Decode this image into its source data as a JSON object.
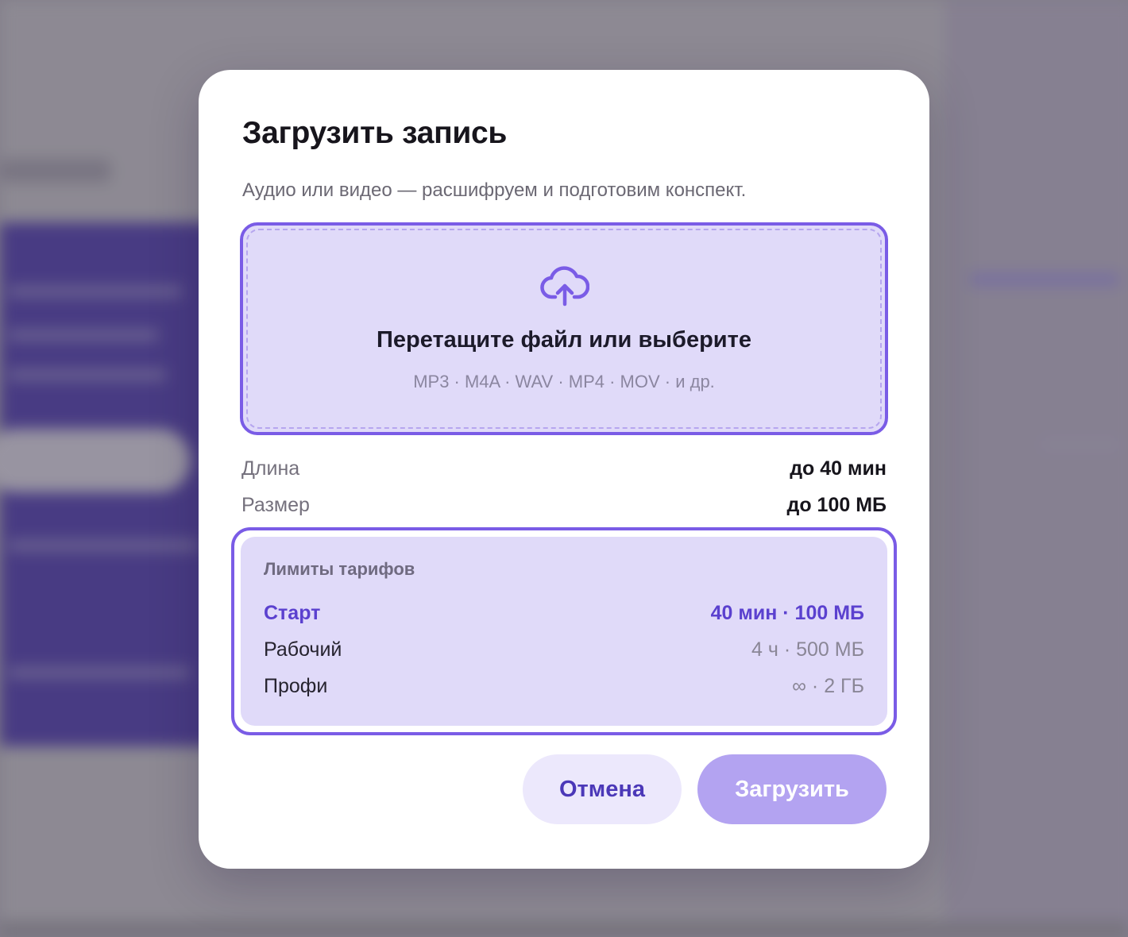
{
  "modal": {
    "title": "Загрузить запись",
    "subtitle": "Аудио или видео — расшифруем и подготовим конспект."
  },
  "dropzone": {
    "icon": "cloud-upload-icon",
    "title": "Перетащите файл или выберите",
    "formats": "MP3 · M4A · WAV · MP4 · MOV · и др."
  },
  "limits": [
    {
      "label": "Длина",
      "value": "до 40 мин"
    },
    {
      "label": "Размер",
      "value": "до 100 МБ"
    }
  ],
  "plans": {
    "heading": "Лимиты тарифов",
    "tiers": [
      {
        "name": "Старт",
        "value": "40 мин · 100 МБ",
        "active": true
      },
      {
        "name": "Рабочий",
        "value": "4 ч · 500 МБ",
        "active": false
      },
      {
        "name": "Профи",
        "value": "∞ · 2 ГБ",
        "active": false
      }
    ]
  },
  "actions": {
    "cancel_label": "Отмена",
    "upload_label": "Загрузить",
    "upload_disabled": true
  },
  "colors": {
    "accent": "#7a5ce6",
    "accent_dark": "#5b41cf",
    "accent_soft": "#e0daf9",
    "upload_button_disabled": "#b3a3f1"
  }
}
